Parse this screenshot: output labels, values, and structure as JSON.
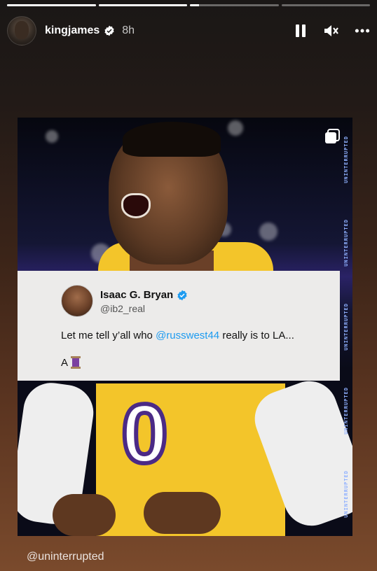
{
  "story": {
    "progress": [
      {
        "fill": 1.0
      },
      {
        "fill": 1.0
      },
      {
        "fill": 0.1
      },
      {
        "fill": 0.0
      }
    ],
    "username": "kingjames",
    "time": "8h",
    "verified_icon": "verified-badge-icon",
    "controls": [
      "pause-icon",
      "mute-icon",
      "more-icon"
    ]
  },
  "post": {
    "side_brand": "UNINTERRUPTED",
    "multi_icon": "carousel-icon",
    "jersey_number": "0",
    "tweet": {
      "name": "Isaac G. Bryan",
      "handle": "@ib2_real",
      "text_before": "Let me tell y’all who ",
      "mention": "@russwest44",
      "text_after": " really is to LA...",
      "line2": "A",
      "emoji_icon": "thread-spool-icon"
    }
  },
  "mention_sticker": "@uninterrupted",
  "colors": {
    "mention": "#1d9bf0",
    "verified": "#1d9bf0",
    "jersey": "#f3c52a",
    "number_stroke": "#4b2a86"
  }
}
